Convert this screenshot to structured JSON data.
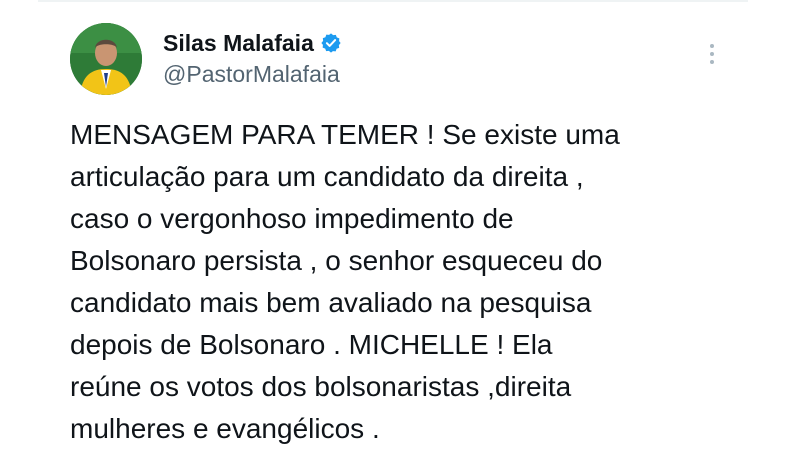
{
  "tweet": {
    "author": {
      "display_name": "Silas Malafaia",
      "handle": "@PastorMalafaia",
      "verified": true,
      "verified_color": "#1d9bf0"
    },
    "text": "MENSAGEM PARA TEMER ! Se existe uma\narticulação para um candidato da direita ,\n caso o vergonhoso impedimento de\nBolsonaro persista , o senhor esqueceu do\ncandidato mais bem avaliado na pesquisa\ndepois de Bolsonaro . MICHELLE ! Ela\nreúne os votos dos bolsonaristas ,direita\nmulheres e evangélicos ."
  },
  "icons": {
    "avatar": "avatar-photo",
    "verified": "verified-badge-icon",
    "more": "more-options-icon"
  }
}
